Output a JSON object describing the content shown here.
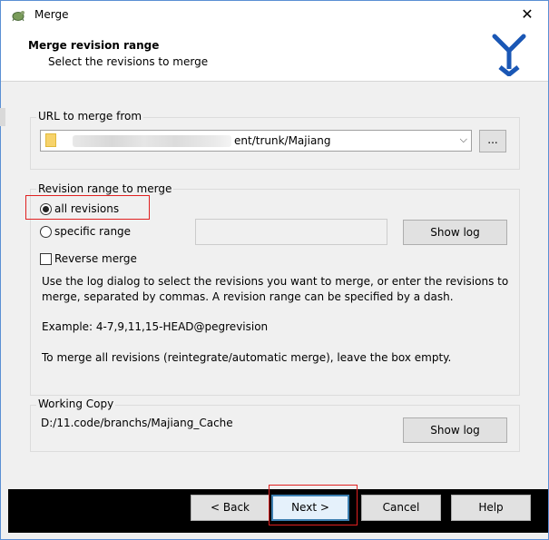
{
  "window": {
    "title": "Merge"
  },
  "header": {
    "title": "Merge revision range",
    "subtitle": "Select the revisions to merge"
  },
  "url_group": {
    "label": "URL to merge from",
    "url_suffix": "ent/trunk/Majiang",
    "browse_label": "..."
  },
  "range_group": {
    "label": "Revision range to merge",
    "all_revisions_label": "all revisions",
    "specific_range_label": "specific range",
    "range_value": "",
    "show_log_label": "Show log",
    "reverse_merge_label": "Reverse merge",
    "help_line1": "Use the log dialog to select the revisions you want to merge, or enter the revisions to merge, separated by commas. A revision range can be specified by a dash.",
    "example": "Example: 4-7,9,11,15-HEAD@pegrevision",
    "help_line2": "To merge all revisions (reintegrate/automatic merge), leave the box empty.",
    "selected": "all revisions",
    "reverse_merge_checked": false
  },
  "working_copy": {
    "label": "Working Copy",
    "path": "D:/11.code/branchs/Majiang_Cache",
    "show_log_label": "Show log"
  },
  "footer": {
    "back_label": "< Back",
    "next_label": "Next >",
    "cancel_label": "Cancel",
    "help_label": "Help"
  },
  "colors": {
    "highlight_box": "#e02020",
    "default_button_border": "#3c7fb1"
  }
}
